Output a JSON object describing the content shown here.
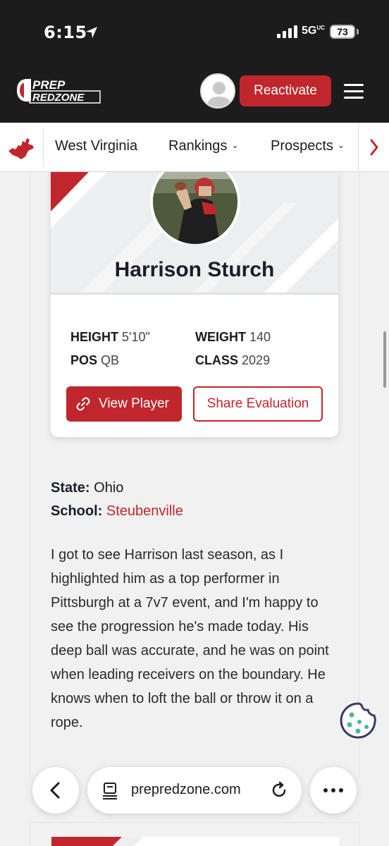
{
  "status": {
    "time": "6:15",
    "network": "5G",
    "network_suffix": "UC",
    "battery": "73"
  },
  "header": {
    "logo_line1": "PREP",
    "logo_line2": "REDZONE",
    "reactivate_label": "Reactivate"
  },
  "nav": {
    "state": "West Virginia",
    "rankings": "Rankings",
    "prospects": "Prospects"
  },
  "player": {
    "name": "Harrison Sturch",
    "height_label": "HEIGHT",
    "height_value": "5'10\"",
    "weight_label": "WEIGHT",
    "weight_value": "140",
    "pos_label": "POS",
    "pos_value": "QB",
    "class_label": "CLASS",
    "class_value": "2029",
    "view_label": "View Player",
    "share_label": "Share Evaluation"
  },
  "details": {
    "state_label": "State:",
    "state_value": "Ohio",
    "school_label": "School:",
    "school_value": "Steubenville"
  },
  "evaluation": "I got to see Harrison last season, as I highlighted him as a top performer in Pittsburgh at a 7v7 event, and I'm happy to see the progression he's made today. His deep ball was accurate, and he was on point when leading receivers on the boundary. He knows when to loft the ball or throw it on a rope.",
  "browser": {
    "url": "prepredzone.com"
  },
  "colors": {
    "brand_red": "#c0272d",
    "dark": "#1c1c1c",
    "cookie": "#3b3a6b"
  },
  "icons": [
    "location-arrow-icon",
    "signal-icon",
    "battery-icon",
    "hamburger-icon",
    "west-virginia-icon",
    "chevron-down-icon",
    "chevron-right-icon",
    "link-icon",
    "cookie-icon",
    "back-icon",
    "reader-icon",
    "reload-icon",
    "more-icon"
  ]
}
